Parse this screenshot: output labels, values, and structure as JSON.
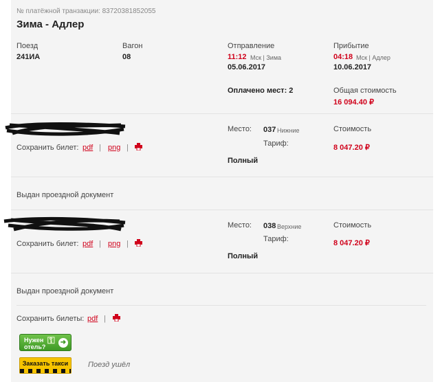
{
  "header": {
    "transaction_label": "№ платёжной транзакции: 83720381852055",
    "route": "Зима - Адлер"
  },
  "trip": {
    "train_label": "Поезд",
    "train_value": "241ИА",
    "wagon_label": "Вагон",
    "wagon_value": "08",
    "departure_label": "Отправление",
    "departure_time": "11:12",
    "departure_tz": "Мск | Зима",
    "departure_date": "05.06.2017",
    "arrival_label": "Прибытие",
    "arrival_time": "04:18",
    "arrival_tz": "Мск | Адлер",
    "arrival_date": "10.06.2017",
    "paid_seats": "Оплачено мест: 2",
    "total_label": "Общая стоимость",
    "total_value": "16 094.40 ₽"
  },
  "tickets": [
    {
      "seat_label": "Место:",
      "seat_number": "037",
      "seat_type": "Нижние",
      "tariff_label": "Тариф:",
      "tariff_value": "Полный",
      "cost_label": "Стоимость",
      "cost_value": "8 047.20 ₽",
      "save_label": "Сохранить билет:",
      "pdf": "pdf",
      "png": "png",
      "sep": "|",
      "status": "Выдан проездной документ"
    },
    {
      "seat_label": "Место:",
      "seat_number": "038",
      "seat_type": "Верхние",
      "tariff_label": "Тариф:",
      "tariff_value": "Полный",
      "cost_label": "Стоимость",
      "cost_value": "8 047.20 ₽",
      "save_label": "Сохранить билет:",
      "pdf": "pdf",
      "png": "png",
      "sep": "|",
      "status": "Выдан проездной документ"
    }
  ],
  "footer": {
    "save_all_label": "Сохранить билеты:",
    "pdf": "pdf",
    "sep": "|",
    "hotel_button": "Нужен отель?",
    "taxi_button": "Заказать такси",
    "train_status": "Поезд ушёл"
  },
  "icons": {
    "print": "printer-icon",
    "arrow": "arrow-right-icon",
    "key": "key-icon"
  },
  "colors": {
    "accent": "#d0021b",
    "panel": "#f4f4f4"
  }
}
